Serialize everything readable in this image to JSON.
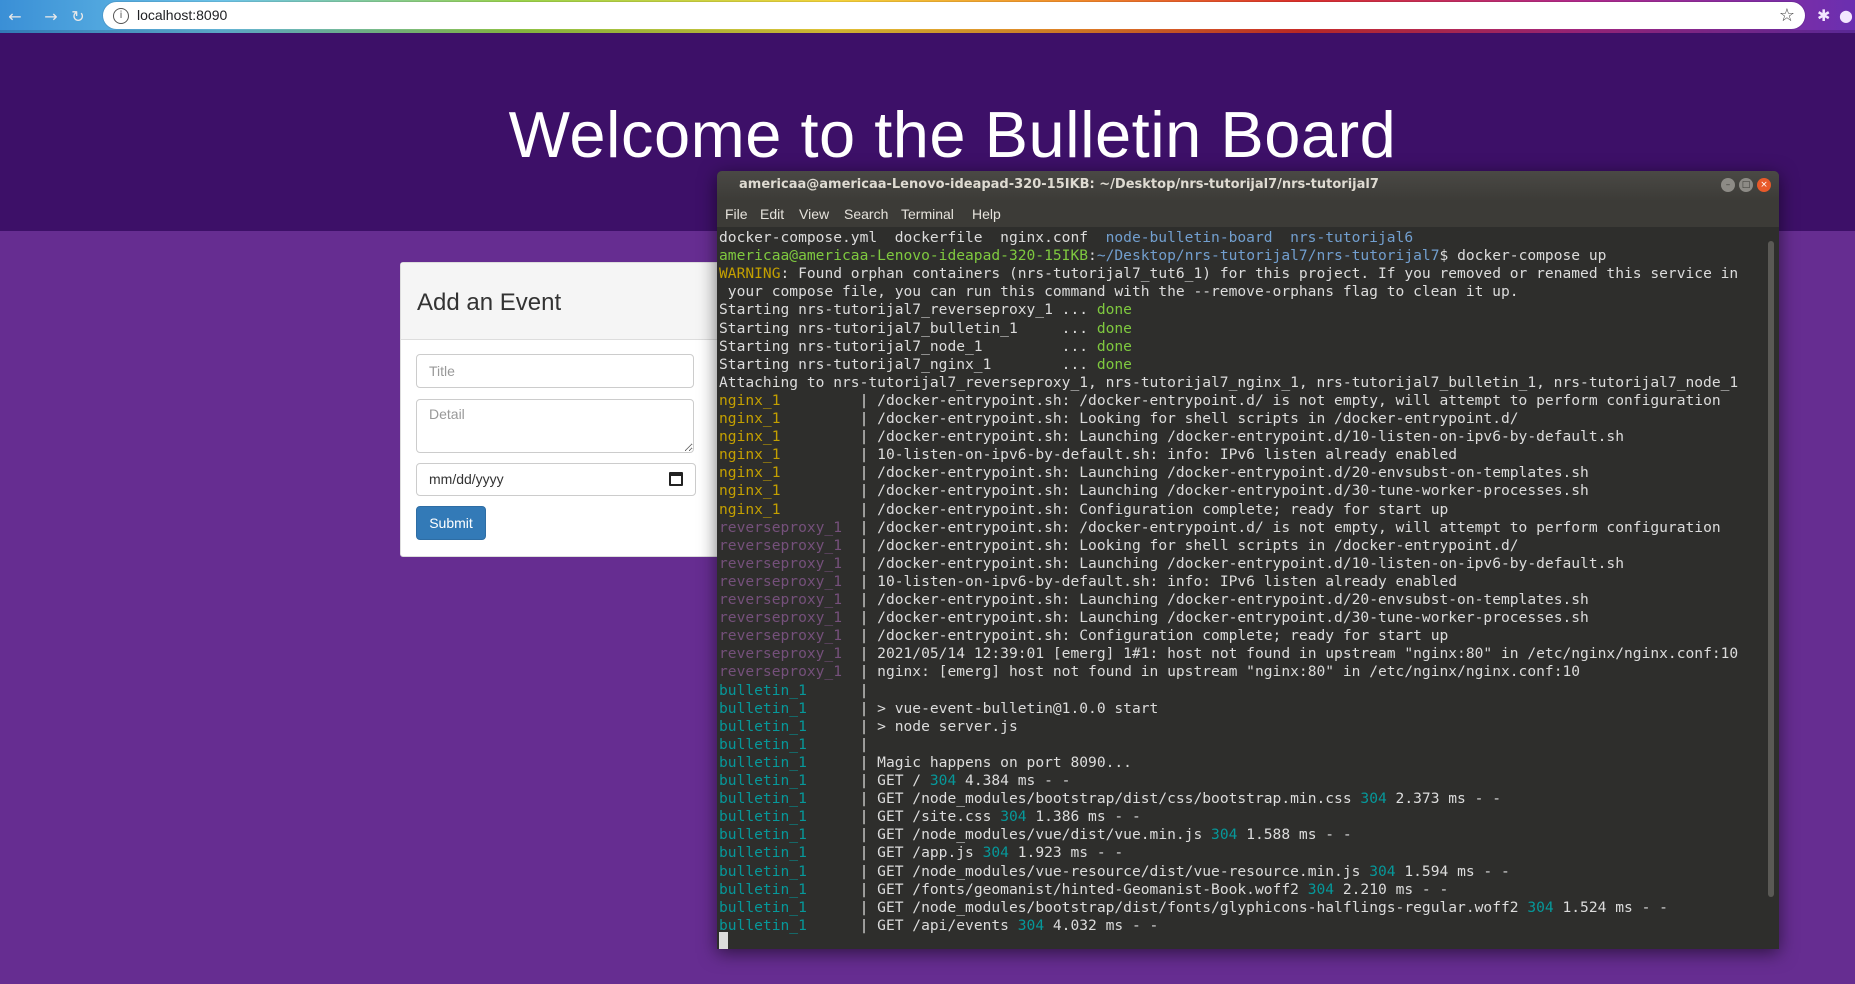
{
  "browser": {
    "url": "localhost:8090",
    "back_icon": "arrow-left-icon",
    "forward_icon": "arrow-right-icon",
    "reload_icon": "reload-icon"
  },
  "page": {
    "title": "Welcome to the Bulletin Board",
    "form": {
      "heading": "Add an Event",
      "title_placeholder": "Title",
      "detail_placeholder": "Detail",
      "date_value": "mm/dd/yyyy",
      "submit_label": "Submit"
    },
    "colors": {
      "hero": "#3d1068",
      "body": "#662d91",
      "submit": "#337ab7"
    }
  },
  "terminal": {
    "title": "americaa@americaa-Lenovo-ideapad-320-15IKB: ~/Desktop/nrs-tutorijal7/nrs-tutorijal7",
    "menu": [
      "File",
      "Edit",
      "View",
      "Search",
      "Terminal",
      "Help"
    ],
    "lines": [
      {
        "segs": [
          [
            "docker-compose.yml  dockerfile  nginx.conf  ",
            ""
          ],
          [
            "node-bulletin-board",
            "c-blue"
          ],
          [
            "  ",
            ""
          ],
          [
            "nrs-tutorijal6",
            "c-blue"
          ]
        ]
      },
      {
        "segs": [
          [
            "americaa@americaa-Lenovo-ideapad-320-15IKB",
            "c-green"
          ],
          [
            ":",
            ""
          ],
          [
            "~/Desktop/nrs-tutorijal7/nrs-tutorijal7",
            "c-blue"
          ],
          [
            "$ docker-compose up",
            ""
          ]
        ]
      },
      {
        "segs": [
          [
            "WARNING",
            "c-orange"
          ],
          [
            ": Found orphan containers (nrs-tutorijal7_tut6_1) for this project. If you removed or renamed this service in",
            ""
          ]
        ]
      },
      {
        "segs": [
          [
            " your compose file, you can run this command with the --remove-orphans flag to clean it up.",
            ""
          ]
        ]
      },
      {
        "segs": [
          [
            "Starting nrs-tutorijal7_reverseproxy_1 ... ",
            ""
          ],
          [
            "done",
            "c-green"
          ]
        ]
      },
      {
        "segs": [
          [
            "Starting nrs-tutorijal7_bulletin_1     ... ",
            ""
          ],
          [
            "done",
            "c-green"
          ]
        ]
      },
      {
        "segs": [
          [
            "Starting nrs-tutorijal7_node_1         ... ",
            ""
          ],
          [
            "done",
            "c-green"
          ]
        ]
      },
      {
        "segs": [
          [
            "Starting nrs-tutorijal7_nginx_1        ... ",
            ""
          ],
          [
            "done",
            "c-green"
          ]
        ]
      },
      {
        "segs": [
          [
            "Attaching to nrs-tutorijal7_reverseproxy_1, nrs-tutorijal7_nginx_1, nrs-tutorijal7_bulletin_1, nrs-tutorijal7_node_1",
            ""
          ]
        ]
      },
      {
        "segs": [
          [
            "nginx_1         ",
            "c-yellow"
          ],
          [
            "| /docker-entrypoint.sh: /docker-entrypoint.d/ is not empty, will attempt to perform configuration",
            ""
          ]
        ]
      },
      {
        "segs": [
          [
            "nginx_1         ",
            "c-yellow"
          ],
          [
            "| /docker-entrypoint.sh: Looking for shell scripts in /docker-entrypoint.d/",
            ""
          ]
        ]
      },
      {
        "segs": [
          [
            "nginx_1         ",
            "c-yellow"
          ],
          [
            "| /docker-entrypoint.sh: Launching /docker-entrypoint.d/10-listen-on-ipv6-by-default.sh",
            ""
          ]
        ]
      },
      {
        "segs": [
          [
            "nginx_1         ",
            "c-yellow"
          ],
          [
            "| 10-listen-on-ipv6-by-default.sh: info: IPv6 listen already enabled",
            ""
          ]
        ]
      },
      {
        "segs": [
          [
            "nginx_1         ",
            "c-yellow"
          ],
          [
            "| /docker-entrypoint.sh: Launching /docker-entrypoint.d/20-envsubst-on-templates.sh",
            ""
          ]
        ]
      },
      {
        "segs": [
          [
            "nginx_1         ",
            "c-yellow"
          ],
          [
            "| /docker-entrypoint.sh: Launching /docker-entrypoint.d/30-tune-worker-processes.sh",
            ""
          ]
        ]
      },
      {
        "segs": [
          [
            "nginx_1         ",
            "c-yellow"
          ],
          [
            "| /docker-entrypoint.sh: Configuration complete; ready for start up",
            ""
          ]
        ]
      },
      {
        "segs": [
          [
            "reverseproxy_1  ",
            "c-purple"
          ],
          [
            "| /docker-entrypoint.sh: /docker-entrypoint.d/ is not empty, will attempt to perform configuration",
            ""
          ]
        ]
      },
      {
        "segs": [
          [
            "reverseproxy_1  ",
            "c-purple"
          ],
          [
            "| /docker-entrypoint.sh: Looking for shell scripts in /docker-entrypoint.d/",
            ""
          ]
        ]
      },
      {
        "segs": [
          [
            "reverseproxy_1  ",
            "c-purple"
          ],
          [
            "| /docker-entrypoint.sh: Launching /docker-entrypoint.d/10-listen-on-ipv6-by-default.sh",
            ""
          ]
        ]
      },
      {
        "segs": [
          [
            "reverseproxy_1  ",
            "c-purple"
          ],
          [
            "| 10-listen-on-ipv6-by-default.sh: info: IPv6 listen already enabled",
            ""
          ]
        ]
      },
      {
        "segs": [
          [
            "reverseproxy_1  ",
            "c-purple"
          ],
          [
            "| /docker-entrypoint.sh: Launching /docker-entrypoint.d/20-envsubst-on-templates.sh",
            ""
          ]
        ]
      },
      {
        "segs": [
          [
            "reverseproxy_1  ",
            "c-purple"
          ],
          [
            "| /docker-entrypoint.sh: Launching /docker-entrypoint.d/30-tune-worker-processes.sh",
            ""
          ]
        ]
      },
      {
        "segs": [
          [
            "reverseproxy_1  ",
            "c-purple"
          ],
          [
            "| /docker-entrypoint.sh: Configuration complete; ready for start up",
            ""
          ]
        ]
      },
      {
        "segs": [
          [
            "reverseproxy_1  ",
            "c-purple"
          ],
          [
            "| 2021/05/14 12:39:01 [emerg] 1#1: host not found in upstream \"nginx:80\" in /etc/nginx/nginx.conf:10",
            ""
          ]
        ]
      },
      {
        "segs": [
          [
            "reverseproxy_1  ",
            "c-purple"
          ],
          [
            "| nginx: [emerg] host not found in upstream \"nginx:80\" in /etc/nginx/nginx.conf:10",
            ""
          ]
        ]
      },
      {
        "segs": [
          [
            "bulletin_1      ",
            "c-cyan"
          ],
          [
            "|",
            ""
          ]
        ]
      },
      {
        "segs": [
          [
            "bulletin_1      ",
            "c-cyan"
          ],
          [
            "| > vue-event-bulletin@1.0.0 start",
            ""
          ]
        ]
      },
      {
        "segs": [
          [
            "bulletin_1      ",
            "c-cyan"
          ],
          [
            "| > node server.js",
            ""
          ]
        ]
      },
      {
        "segs": [
          [
            "bulletin_1      ",
            "c-cyan"
          ],
          [
            "|",
            ""
          ]
        ]
      },
      {
        "segs": [
          [
            "bulletin_1      ",
            "c-cyan"
          ],
          [
            "| Magic happens on port 8090...",
            ""
          ]
        ]
      },
      {
        "segs": [
          [
            "bulletin_1      ",
            "c-cyan"
          ],
          [
            "| GET / ",
            ""
          ],
          [
            "304",
            "c-cyan"
          ],
          [
            " 4.384 ms - -",
            ""
          ]
        ]
      },
      {
        "segs": [
          [
            "bulletin_1      ",
            "c-cyan"
          ],
          [
            "| GET /node_modules/bootstrap/dist/css/bootstrap.min.css ",
            ""
          ],
          [
            "304",
            "c-cyan"
          ],
          [
            " 2.373 ms - -",
            ""
          ]
        ]
      },
      {
        "segs": [
          [
            "bulletin_1      ",
            "c-cyan"
          ],
          [
            "| GET /site.css ",
            ""
          ],
          [
            "304",
            "c-cyan"
          ],
          [
            " 1.386 ms - -",
            ""
          ]
        ]
      },
      {
        "segs": [
          [
            "bulletin_1      ",
            "c-cyan"
          ],
          [
            "| GET /node_modules/vue/dist/vue.min.js ",
            ""
          ],
          [
            "304",
            "c-cyan"
          ],
          [
            " 1.588 ms - -",
            ""
          ]
        ]
      },
      {
        "segs": [
          [
            "bulletin_1      ",
            "c-cyan"
          ],
          [
            "| GET /app.js ",
            ""
          ],
          [
            "304",
            "c-cyan"
          ],
          [
            " 1.923 ms - -",
            ""
          ]
        ]
      },
      {
        "segs": [
          [
            "bulletin_1      ",
            "c-cyan"
          ],
          [
            "| GET /node_modules/vue-resource/dist/vue-resource.min.js ",
            ""
          ],
          [
            "304",
            "c-cyan"
          ],
          [
            " 1.594 ms - -",
            ""
          ]
        ]
      },
      {
        "segs": [
          [
            "bulletin_1      ",
            "c-cyan"
          ],
          [
            "| GET /fonts/geomanist/hinted-Geomanist-Book.woff2 ",
            ""
          ],
          [
            "304",
            "c-cyan"
          ],
          [
            " 2.210 ms - -",
            ""
          ]
        ]
      },
      {
        "segs": [
          [
            "bulletin_1      ",
            "c-cyan"
          ],
          [
            "| GET /node_modules/bootstrap/dist/fonts/glyphicons-halflings-regular.woff2 ",
            ""
          ],
          [
            "304",
            "c-cyan"
          ],
          [
            " 1.524 ms - -",
            ""
          ]
        ]
      },
      {
        "segs": [
          [
            "bulletin_1      ",
            "c-cyan"
          ],
          [
            "| GET /api/events ",
            ""
          ],
          [
            "304",
            "c-cyan"
          ],
          [
            " 4.032 ms - -",
            ""
          ]
        ]
      }
    ]
  }
}
